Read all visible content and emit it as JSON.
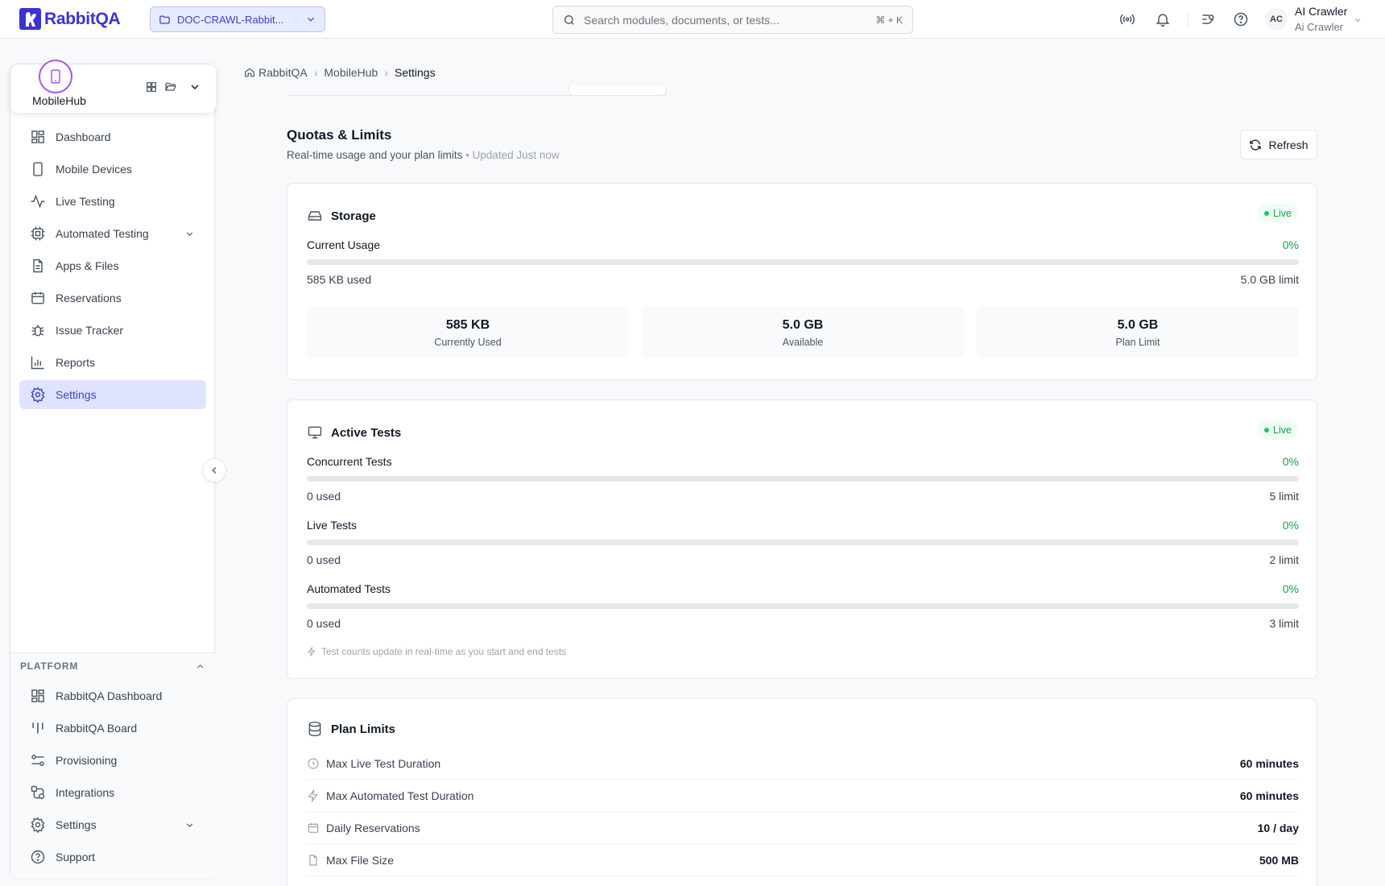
{
  "app": {
    "name": "RabbitQA"
  },
  "header": {
    "project": "DOC-CRAWL-Rabbit...",
    "search_placeholder": "Search modules, documents, or tests...",
    "search_shortcut": "⌘ + K",
    "user": {
      "initials": "AC",
      "name": "AI Crawler",
      "subtitle": "Ai Crawler"
    }
  },
  "sidebar": {
    "workspace": "MobileHub",
    "items": [
      {
        "label": "Dashboard",
        "icon": "dashboard-icon"
      },
      {
        "label": "Mobile Devices",
        "icon": "smartphone-icon"
      },
      {
        "label": "Live Testing",
        "icon": "activity-icon"
      },
      {
        "label": "Automated Testing",
        "icon": "cpu-icon",
        "expandable": true
      },
      {
        "label": "Apps & Files",
        "icon": "file-icon"
      },
      {
        "label": "Reservations",
        "icon": "calendar-icon"
      },
      {
        "label": "Issue Tracker",
        "icon": "bug-icon"
      },
      {
        "label": "Reports",
        "icon": "bar-chart-icon"
      },
      {
        "label": "Settings",
        "icon": "gear-icon",
        "active": true
      }
    ],
    "platform": {
      "heading": "PLATFORM",
      "items": [
        {
          "label": "RabbitQA Dashboard",
          "icon": "dashboard-icon"
        },
        {
          "label": "RabbitQA Board",
          "icon": "kanban-icon"
        },
        {
          "label": "Provisioning",
          "icon": "sliders-icon"
        },
        {
          "label": "Integrations",
          "icon": "integrations-icon"
        },
        {
          "label": "Settings",
          "icon": "gear-icon",
          "expandable": true
        },
        {
          "label": "Support",
          "icon": "help-icon"
        }
      ]
    }
  },
  "breadcrumb": {
    "root": "RabbitQA",
    "section": "MobileHub",
    "current": "Settings"
  },
  "quotas": {
    "title": "Quotas & Limits",
    "subtitle": "Real-time usage and your plan limits",
    "updated": "• Updated Just now",
    "refresh_label": "Refresh"
  },
  "storage": {
    "title": "Storage",
    "badge": "Live",
    "label": "Current Usage",
    "percent": "0%",
    "fill_fraction": 0,
    "used": "585 KB used",
    "limit": "5.0 GB limit",
    "stats": [
      {
        "value": "585 KB",
        "label": "Currently Used"
      },
      {
        "value": "5.0 GB",
        "label": "Available"
      },
      {
        "value": "5.0 GB",
        "label": "Plan Limit"
      }
    ]
  },
  "active_tests": {
    "title": "Active Tests",
    "badge": "Live",
    "metrics": [
      {
        "label": "Concurrent Tests",
        "percent": "0%",
        "fill_fraction": 0,
        "used": "0 used",
        "limit": "5 limit"
      },
      {
        "label": "Live Tests",
        "percent": "0%",
        "fill_fraction": 0,
        "used": "0 used",
        "limit": "2 limit"
      },
      {
        "label": "Automated Tests",
        "percent": "0%",
        "fill_fraction": 0,
        "used": "0 used",
        "limit": "3 limit"
      }
    ],
    "note": "Test counts update in real-time as you start and end tests"
  },
  "plan_limits": {
    "title": "Plan Limits",
    "rows": [
      {
        "label": "Max Live Test Duration",
        "value": "60 minutes",
        "icon": "clock-icon"
      },
      {
        "label": "Max Automated Test Duration",
        "value": "60 minutes",
        "icon": "zap-icon"
      },
      {
        "label": "Daily Reservations",
        "value": "10 / day",
        "icon": "calendar-icon"
      },
      {
        "label": "Max File Size",
        "value": "500 MB",
        "icon": "file-icon"
      }
    ]
  },
  "colors": {
    "accent": "#3b33d1",
    "active_bg": "#dfe3ff",
    "live_green": "#16a34a",
    "workspace_ring": "#a855f7"
  }
}
